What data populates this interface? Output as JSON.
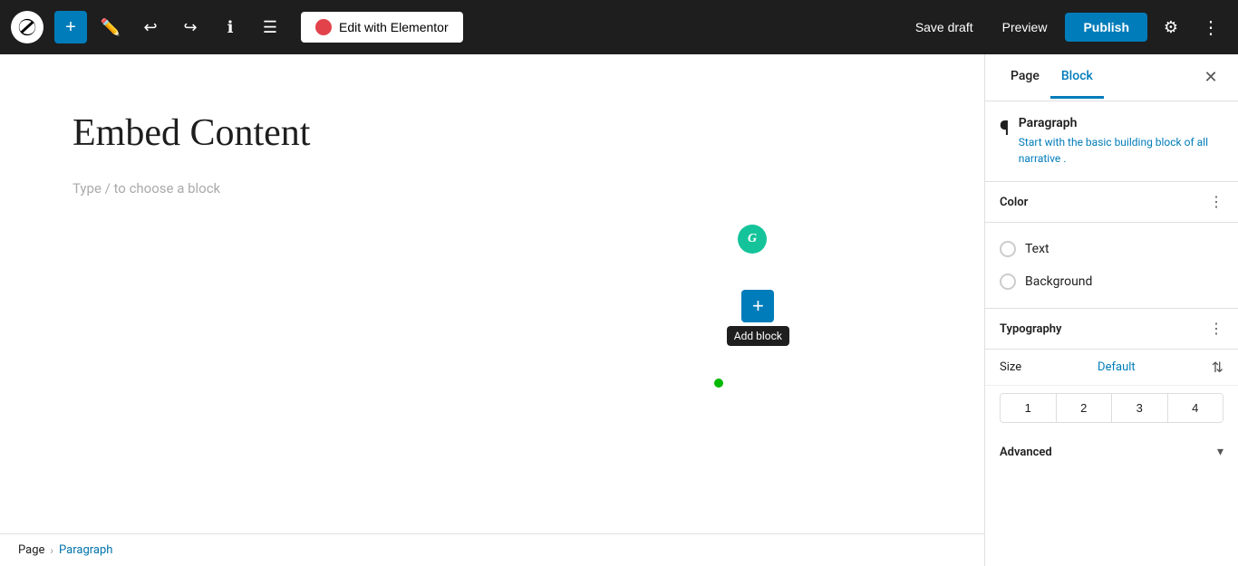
{
  "toolbar": {
    "edit_elementor_label": "Edit with Elementor",
    "save_draft_label": "Save draft",
    "preview_label": "Preview",
    "publish_label": "Publish"
  },
  "editor": {
    "page_title": "Embed Content",
    "block_placeholder": "Type / to choose a block",
    "add_block_tooltip": "Add block"
  },
  "breadcrumb": {
    "page_label": "Page",
    "separator": "›",
    "current": "Paragraph"
  },
  "sidebar": {
    "tab_page": "Page",
    "tab_block": "Block",
    "paragraph_title": "Paragraph",
    "paragraph_desc_before": "Start with the basic building block of",
    "paragraph_highlight": "all narrative",
    "paragraph_desc_after": ".",
    "color_section_title": "Color",
    "text_label": "Text",
    "background_label": "Background",
    "typography_section_title": "Typography",
    "size_label": "Size",
    "size_value": "Default",
    "size_options": [
      "1",
      "2",
      "3",
      "4"
    ],
    "advanced_section_title": "Advanced"
  }
}
